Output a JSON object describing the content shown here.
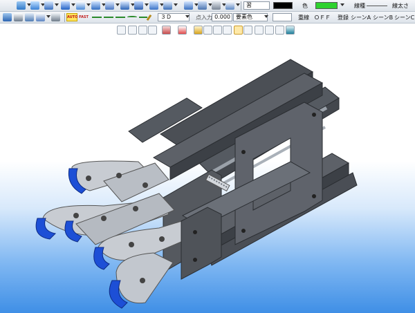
{
  "toolbar_top": {
    "layer_value": "習",
    "color_label": "色",
    "line_color": "#000000",
    "fill_color": "#2ed22e",
    "linetype_label": "線種",
    "linewidth_label": "線太さ"
  },
  "toolbar_second": {
    "auto_label": "AUTO",
    "fast_label": "FAST",
    "mode_value": "３Ｄ",
    "point_input_label": "点入力",
    "point_input_value": "0.000",
    "element_color_label": "要素色",
    "overlap_label": "重線",
    "overlap_state": "ＯＦＦ",
    "register_label": "登録",
    "scene_a": "シーンA",
    "scene_b": "シーンB",
    "scene_c": "シーンC"
  },
  "model_colors": {
    "frame": "#4b4f55",
    "plate": "#5f636b",
    "fingertip": "#1d4fd6",
    "joint": "#c8ccd2"
  }
}
